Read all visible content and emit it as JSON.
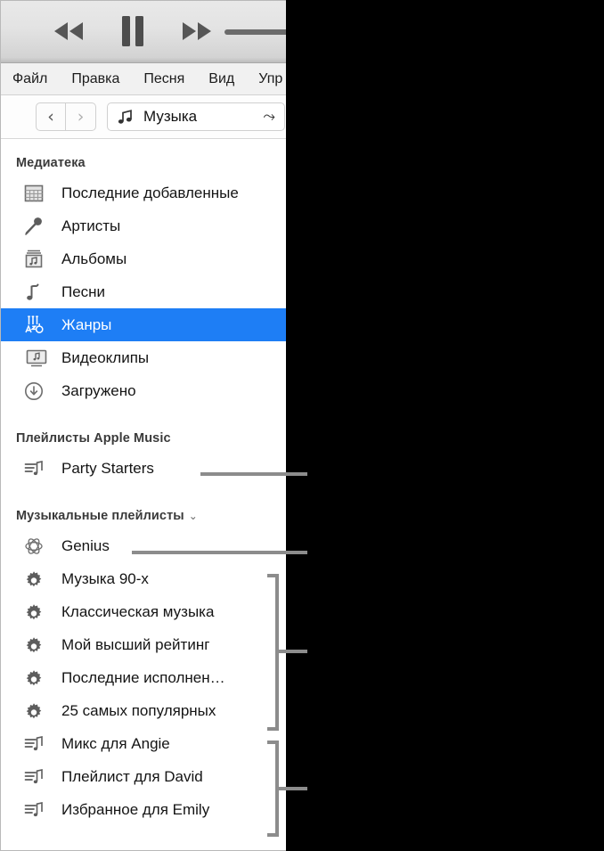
{
  "window": {
    "player": {
      "rewind_label": "Перемотка назад",
      "pause_label": "Пауза",
      "forward_label": "Перемотка вперёд",
      "volume_label": "Громкость"
    },
    "menu_bar": {
      "items": [
        {
          "label": "Файл"
        },
        {
          "label": "Правка"
        },
        {
          "label": "Песня"
        },
        {
          "label": "Вид"
        },
        {
          "label": "Упр"
        }
      ]
    },
    "nav": {
      "back_glyph": "‹",
      "forward_glyph": "›",
      "source_label": "Музыка",
      "source_tail_glyph": "⤳"
    },
    "sidebar": {
      "library": {
        "header": "Медиатека",
        "items": [
          {
            "label": "Последние добавленные",
            "icon": "grid-icon",
            "selected": false
          },
          {
            "label": "Артисты",
            "icon": "microphone-icon",
            "selected": false
          },
          {
            "label": "Альбомы",
            "icon": "album-icon",
            "selected": false
          },
          {
            "label": "Песни",
            "icon": "note-icon",
            "selected": false
          },
          {
            "label": "Жанры",
            "icon": "guitar-icon",
            "selected": true
          },
          {
            "label": "Видеоклипы",
            "icon": "video-icon",
            "selected": false
          },
          {
            "label": "Загружено",
            "icon": "download-icon",
            "selected": false
          }
        ]
      },
      "apple_music": {
        "header": "Плейлисты Apple Music",
        "items": [
          {
            "label": "Party Starters",
            "icon": "playlist-icon"
          }
        ]
      },
      "music_playlists": {
        "header": "Музыкальные плейлисты",
        "caret": "⌄",
        "items": [
          {
            "label": "Genius",
            "icon": "genius-icon"
          },
          {
            "label": "Музыка 90-х",
            "icon": "gear-icon"
          },
          {
            "label": "Классическая музыка",
            "icon": "gear-icon"
          },
          {
            "label": "Мой высший рейтинг",
            "icon": "gear-icon"
          },
          {
            "label": "Последние исполнен…",
            "icon": "gear-icon"
          },
          {
            "label": "25 самых популярных",
            "icon": "gear-icon"
          },
          {
            "label": "Микс для Angie",
            "icon": "playlist-icon"
          },
          {
            "label": "Плейлист для David",
            "icon": "playlist-icon"
          },
          {
            "label": "Избранное для Emily",
            "icon": "playlist-icon"
          }
        ]
      }
    }
  },
  "colors": {
    "selection": "#1e7ef5",
    "callout": "#8c8c8c",
    "menu_bg": "#f1f1f1",
    "player_bg": "#e0e0e0"
  }
}
